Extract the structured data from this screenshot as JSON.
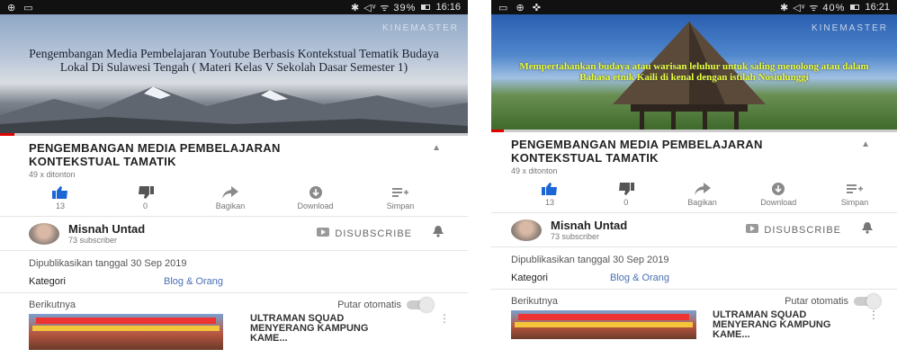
{
  "left": {
    "status": {
      "left": "⊕ ▭",
      "right": "✱ ◁ᵛ ᯤ 39%",
      "time": "16:16"
    },
    "video": {
      "watermark": "KINEMASTER",
      "overlay_text": "Pengembangan Media Pembelajaran Youtube Berbasis Kontekstual Tematik Budaya Lokal Di Sulawesi Tengah ( Materi Kelas V Sekolah Dasar Semester 1)"
    },
    "title": "PENGEMBANGAN MEDIA PEMBELAJARAN KONTEKSTUAL TAMATIK",
    "views": "49 x ditonton",
    "actions": [
      {
        "label": "13",
        "icon": "thumb-up-icon"
      },
      {
        "label": "0",
        "icon": "thumb-down-icon"
      },
      {
        "label": "Bagikan",
        "icon": "share-icon"
      },
      {
        "label": "Download",
        "icon": "download-icon"
      },
      {
        "label": "Simpan",
        "icon": "save-playlist-icon"
      }
    ],
    "channel": {
      "name": "Misnah Untad",
      "subs": "73 subscriber",
      "unsubscribe": "DISUBSCRIBE"
    },
    "published": "Dipublikasikan tanggal 30 Sep 2019",
    "category_key": "Kategori",
    "category_value": "Blog & Orang",
    "upnext": "Berikutnya",
    "autoplay": "Putar otomatis",
    "next_title": "ULTRAMAN SQUAD MENYERANG KAMPUNG KAME..."
  },
  "right": {
    "status": {
      "left": "▭ ⊕ ✜",
      "right": "✱ ◁ᵛ ᯤ 40%",
      "time": "16:21"
    },
    "video": {
      "watermark": "KINEMASTER",
      "overlay_text": "Mempertahankan budaya atau warisan leluhur untuk saling menolong atau dalam Bahasa etnik Kaili di kenal dengan istilah Nosiulunggi"
    },
    "title": "PENGEMBANGAN MEDIA PEMBELAJARAN KONTEKSTUAL TAMATIK",
    "views": "49 x ditonton",
    "actions": [
      {
        "label": "13",
        "icon": "thumb-up-icon"
      },
      {
        "label": "0",
        "icon": "thumb-down-icon"
      },
      {
        "label": "Bagikan",
        "icon": "share-icon"
      },
      {
        "label": "Download",
        "icon": "download-icon"
      },
      {
        "label": "Simpan",
        "icon": "save-playlist-icon"
      }
    ],
    "channel": {
      "name": "Misnah Untad",
      "subs": "73 subscriber",
      "unsubscribe": "DISUBSCRIBE"
    },
    "published": "Dipublikasikan tanggal 30 Sep 2019",
    "category_key": "Kategori",
    "category_value": "Blog & Orang",
    "upnext": "Berikutnya",
    "autoplay": "Putar otomatis",
    "next_title": "ULTRAMAN SQUAD MENYERANG KAMPUNG KAME..."
  },
  "colors": {
    "like_active": "#1a66d4",
    "icon_gray": "#8a8a8a",
    "link": "#4a6fb5",
    "progress": "#e10000"
  }
}
